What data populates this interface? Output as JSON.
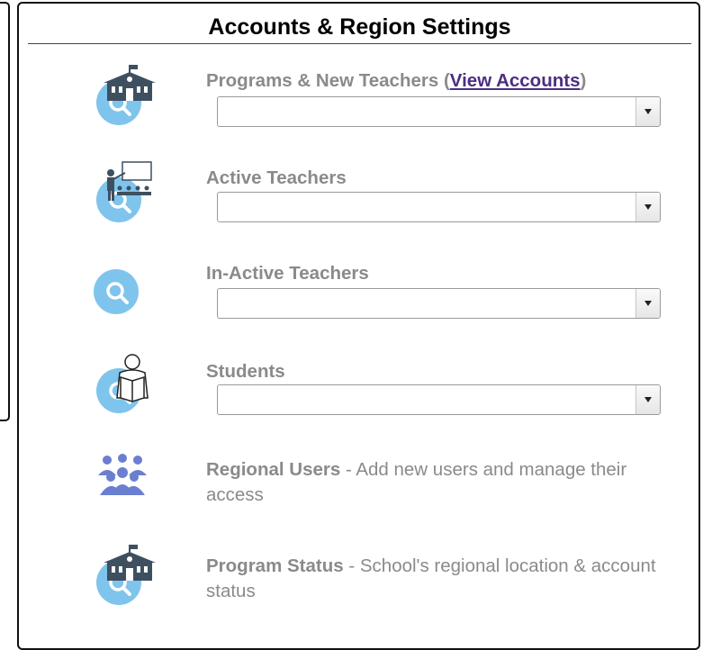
{
  "panel": {
    "title": "Accounts & Region Settings"
  },
  "rows": {
    "programs": {
      "label": "Programs & New Teachers",
      "link_open": "(",
      "link_text": "View Accounts",
      "link_close": ")",
      "selected": ""
    },
    "active_teachers": {
      "label": "Active Teachers",
      "selected": ""
    },
    "inactive_teachers": {
      "label": "In-Active Teachers",
      "selected": ""
    },
    "students": {
      "label": "Students",
      "selected": ""
    },
    "regional_users": {
      "title": "Regional Users",
      "description": " - Add new users and manage their access"
    },
    "program_status": {
      "title": "Program Status",
      "description": " - School's regional location & account status"
    }
  },
  "icons": {
    "school": "school-search-icon",
    "teacher": "teacher-class-search-icon",
    "search": "search-icon",
    "student": "student-reading-search-icon",
    "users": "users-group-icon"
  },
  "colors": {
    "icon_blue": "#7fc4ec",
    "icon_dark": "#3e4f60",
    "users_purple": "#6b7fd0",
    "label_gray": "#8a8a8a",
    "link_purple": "#4b2e83"
  }
}
